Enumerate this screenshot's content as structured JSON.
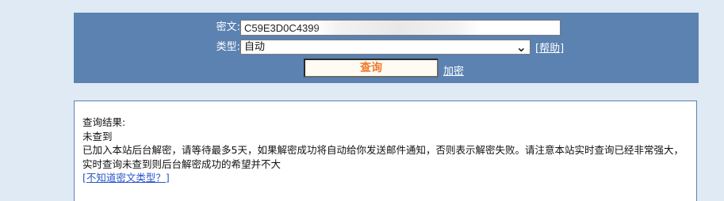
{
  "form": {
    "cipher_label": "密文:",
    "cipher_value": "C59E3D0C4399",
    "type_label": "类型:",
    "type_value": "自动",
    "help_link": "[帮助]",
    "query_button": "查询",
    "encrypt_link": "加密"
  },
  "result": {
    "heading": "查询结果:",
    "status": "未查到",
    "message": "已加入本站后台解密，请等待最多5天，如果解密成功将自动给你发送邮件通知，否则表示解密失败。请注意本站实时查询已经非常强大，实时查询未查到则后台解密成功的希望并不大",
    "type_help_link": "[不知道密文类型？]"
  },
  "colors": {
    "panel_bg": "#5b82b1",
    "page_bg": "#dfeaf5",
    "button_text": "#f07b2a",
    "link": "#2a54c9"
  },
  "icons": {
    "select_arrow": "chevron-down-icon"
  }
}
